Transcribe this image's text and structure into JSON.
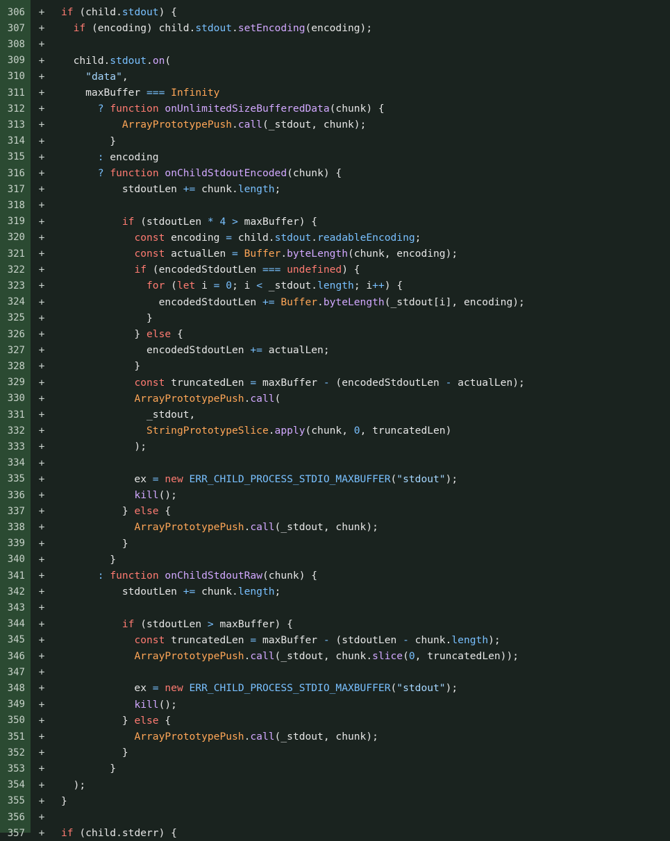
{
  "diff": {
    "marker": "+",
    "rows": [
      {
        "line": "306",
        "code": "if (child.stdout) {"
      },
      {
        "line": "307",
        "code": "  if (encoding) child.stdout.setEncoding(encoding);"
      },
      {
        "line": "308",
        "code": ""
      },
      {
        "line": "309",
        "code": "  child.stdout.on("
      },
      {
        "line": "310",
        "code": "    \"data\","
      },
      {
        "line": "311",
        "code": "    maxBuffer === Infinity"
      },
      {
        "line": "312",
        "code": "      ? function onUnlimitedSizeBufferedData(chunk) {"
      },
      {
        "line": "313",
        "code": "          ArrayPrototypePush.call(_stdout, chunk);"
      },
      {
        "line": "314",
        "code": "        }"
      },
      {
        "line": "315",
        "code": "      : encoding"
      },
      {
        "line": "316",
        "code": "      ? function onChildStdoutEncoded(chunk) {"
      },
      {
        "line": "317",
        "code": "          stdoutLen += chunk.length;"
      },
      {
        "line": "318",
        "code": ""
      },
      {
        "line": "319",
        "code": "          if (stdoutLen * 4 > maxBuffer) {"
      },
      {
        "line": "320",
        "code": "            const encoding = child.stdout.readableEncoding;"
      },
      {
        "line": "321",
        "code": "            const actualLen = Buffer.byteLength(chunk, encoding);"
      },
      {
        "line": "322",
        "code": "            if (encodedStdoutLen === undefined) {"
      },
      {
        "line": "323",
        "code": "              for (let i = 0; i < _stdout.length; i++) {"
      },
      {
        "line": "324",
        "code": "                encodedStdoutLen += Buffer.byteLength(_stdout[i], encoding);"
      },
      {
        "line": "325",
        "code": "              }"
      },
      {
        "line": "326",
        "code": "            } else {"
      },
      {
        "line": "327",
        "code": "              encodedStdoutLen += actualLen;"
      },
      {
        "line": "328",
        "code": "            }"
      },
      {
        "line": "329",
        "code": "            const truncatedLen = maxBuffer - (encodedStdoutLen - actualLen);"
      },
      {
        "line": "330",
        "code": "            ArrayPrototypePush.call("
      },
      {
        "line": "331",
        "code": "              _stdout,"
      },
      {
        "line": "332",
        "code": "              StringPrototypeSlice.apply(chunk, 0, truncatedLen)"
      },
      {
        "line": "333",
        "code": "            );"
      },
      {
        "line": "334",
        "code": ""
      },
      {
        "line": "335",
        "code": "            ex = new ERR_CHILD_PROCESS_STDIO_MAXBUFFER(\"stdout\");"
      },
      {
        "line": "336",
        "code": "            kill();"
      },
      {
        "line": "337",
        "code": "          } else {"
      },
      {
        "line": "338",
        "code": "            ArrayPrototypePush.call(_stdout, chunk);"
      },
      {
        "line": "339",
        "code": "          }"
      },
      {
        "line": "340",
        "code": "        }"
      },
      {
        "line": "341",
        "code": "      : function onChildStdoutRaw(chunk) {"
      },
      {
        "line": "342",
        "code": "          stdoutLen += chunk.length;"
      },
      {
        "line": "343",
        "code": ""
      },
      {
        "line": "344",
        "code": "          if (stdoutLen > maxBuffer) {"
      },
      {
        "line": "345",
        "code": "            const truncatedLen = maxBuffer - (stdoutLen - chunk.length);"
      },
      {
        "line": "346",
        "code": "            ArrayPrototypePush.call(_stdout, chunk.slice(0, truncatedLen));"
      },
      {
        "line": "347",
        "code": ""
      },
      {
        "line": "348",
        "code": "            ex = new ERR_CHILD_PROCESS_STDIO_MAXBUFFER(\"stdout\");"
      },
      {
        "line": "349",
        "code": "            kill();"
      },
      {
        "line": "350",
        "code": "          } else {"
      },
      {
        "line": "351",
        "code": "            ArrayPrototypePush.call(_stdout, chunk);"
      },
      {
        "line": "352",
        "code": "          }"
      },
      {
        "line": "353",
        "code": "        }"
      },
      {
        "line": "354",
        "code": "  );"
      },
      {
        "line": "355",
        "code": "}"
      },
      {
        "line": "356",
        "code": ""
      },
      {
        "line": "357",
        "code": "if (child.stderr) {"
      }
    ]
  }
}
